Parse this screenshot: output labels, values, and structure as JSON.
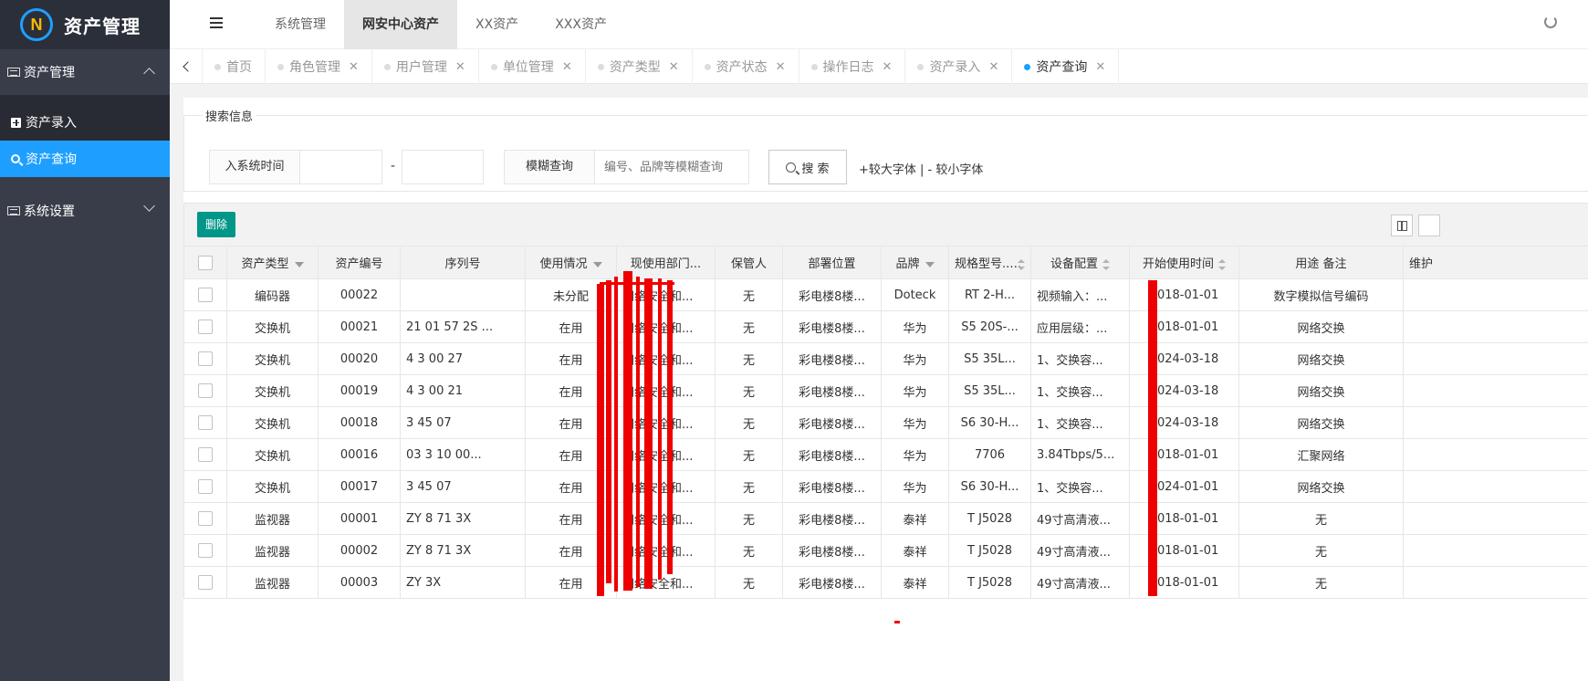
{
  "app": {
    "title": "资产管理",
    "logo_glyph": "N"
  },
  "sidebar": {
    "groups": [
      {
        "label": "资产管理",
        "expanded": true
      },
      {
        "label": "系统设置",
        "expanded": false
      }
    ],
    "items": [
      {
        "label": "资产录入",
        "active": false
      },
      {
        "label": "资产查询",
        "active": true
      }
    ]
  },
  "header": {
    "nav": [
      "系统管理",
      "网安中心资产",
      "XX资产",
      "XXX资产"
    ],
    "active_nav": "网安中心资产"
  },
  "tabs": [
    {
      "label": "首页",
      "closable": false,
      "active": false
    },
    {
      "label": "角色管理",
      "closable": true,
      "active": false
    },
    {
      "label": "用户管理",
      "closable": true,
      "active": false
    },
    {
      "label": "单位管理",
      "closable": true,
      "active": false
    },
    {
      "label": "资产类型",
      "closable": true,
      "active": false
    },
    {
      "label": "资产状态",
      "closable": true,
      "active": false
    },
    {
      "label": "操作日志",
      "closable": true,
      "active": false
    },
    {
      "label": "资产录入",
      "closable": true,
      "active": false
    },
    {
      "label": "资产查询",
      "closable": true,
      "active": true
    }
  ],
  "search": {
    "legend": "搜索信息",
    "time_label": "入系统时间",
    "time_start": "",
    "time_end": "",
    "range_separator": "-",
    "fuzzy_label": "模糊查询",
    "fuzzy_placeholder": "编号、品牌等模糊查询",
    "button_label": "搜 索",
    "font_tools": "+较大字体 | - 较小字体"
  },
  "toolbar": {
    "delete_label": "删除"
  },
  "table": {
    "columns": [
      "资产类型",
      "资产编号",
      "序列号",
      "使用情况",
      "现使用部门...",
      "保管人",
      "部署位置",
      "品牌",
      "规格型号...",
      "设备配置",
      "开始使用时间",
      "用途 备注",
      "维护"
    ],
    "rows": [
      [
        "编码器",
        "00022",
        "",
        "未分配",
        "网络安全和...",
        "无",
        "彩电楼8楼...",
        "Doteck",
        "RT 2-H...",
        "视频输入：...",
        "2018-01-01",
        "数字模拟信号编码"
      ],
      [
        "交换机",
        "00021",
        "21 01 57 2S ...",
        "在用",
        "网络安全和...",
        "无",
        "彩电楼8楼...",
        "华为",
        "S5 20S-...",
        "应用层级：...",
        "2018-01-01",
        "网络交换"
      ],
      [
        "交换机",
        "00020",
        "4 3 00 27",
        "在用",
        "网络安全和...",
        "无",
        "彩电楼8楼...",
        "华为",
        "S5 35L...",
        "1、交换容...",
        "2024-03-18",
        "网络交换"
      ],
      [
        "交换机",
        "00019",
        "4 3 00 21",
        "在用",
        "网络安全和...",
        "无",
        "彩电楼8楼...",
        "华为",
        "S5 35L...",
        "1、交换容...",
        "2024-03-18",
        "网络交换"
      ],
      [
        "交换机",
        "00018",
        "3 45 07",
        "在用",
        "网络安全和...",
        "无",
        "彩电楼8楼...",
        "华为",
        "S6 30-H...",
        "1、交换容...",
        "2024-03-18",
        "网络交换"
      ],
      [
        "交换机",
        "00016",
        "03 3 10 00...",
        "在用",
        "网络安全和...",
        "无",
        "彩电楼8楼...",
        "华为",
        "7706",
        "3.84Tbps/5...",
        "2018-01-01",
        "汇聚网络"
      ],
      [
        "交换机",
        "00017",
        "3 45 07",
        "在用",
        "网络安全和...",
        "无",
        "彩电楼8楼...",
        "华为",
        "S6 30-H...",
        "1、交换容...",
        "2024-01-01",
        "网络交换"
      ],
      [
        "监视器",
        "00001",
        "ZY 8 71 3X",
        "在用",
        "网络安全和...",
        "无",
        "彩电楼8楼...",
        "泰祥",
        "T J5028",
        "49寸高清液...",
        "2018-01-01",
        "无"
      ],
      [
        "监视器",
        "00002",
        "ZY 8 71 3X",
        "在用",
        "网络安全和...",
        "无",
        "彩电楼8楼...",
        "泰祥",
        "T J5028",
        "49寸高清液...",
        "2018-01-01",
        "无"
      ],
      [
        "监视器",
        "00003",
        "ZY 3X",
        "在用",
        "网络安全和...",
        "无",
        "彩电楼8楼...",
        "泰祥",
        "T J5028",
        "49寸高清液...",
        "2018-01-01",
        "无"
      ]
    ]
  },
  "colors": {
    "accent": "#1e9fff",
    "delete_button": "#009688",
    "sidebar": "#393d49",
    "redaction": "#ee0000"
  }
}
